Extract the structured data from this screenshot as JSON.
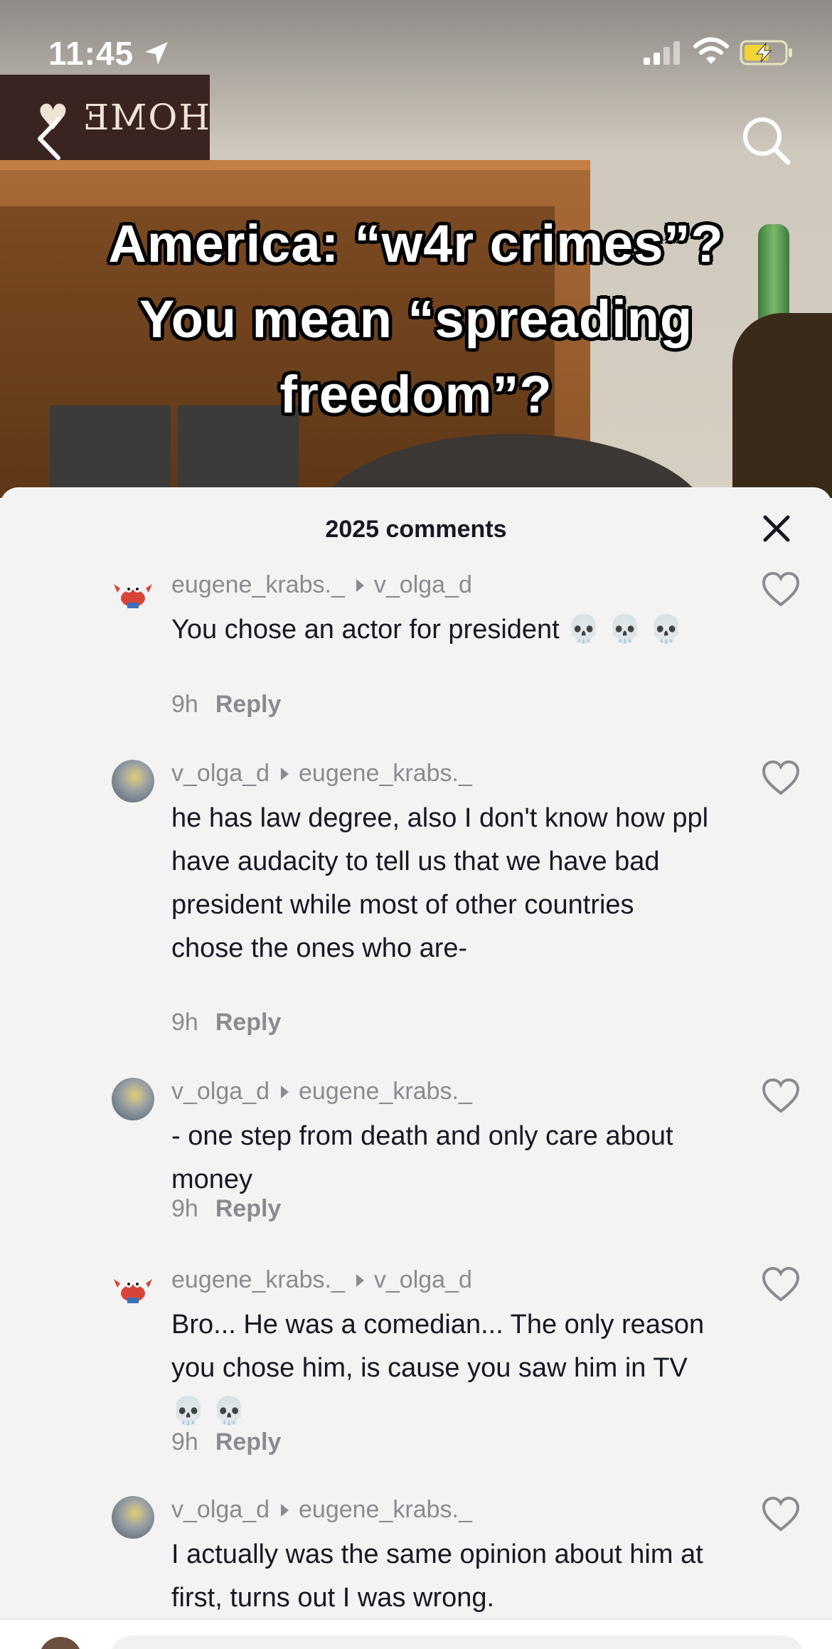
{
  "status_bar": {
    "time": "11:45"
  },
  "video": {
    "sign_text": "HOME ♥ HE",
    "caption_lines": [
      "America: “w4r crimes”?",
      "You mean “spreading",
      "freedom”?"
    ]
  },
  "comments_panel": {
    "title": "2025 comments",
    "comments": [
      {
        "user": "eugene_krabs._",
        "reply_to": "v_olga_d",
        "avatar": "krabs",
        "text": "You chose an actor for president 💀 💀 💀",
        "age": "9h",
        "reply_label": "Reply"
      },
      {
        "user": "v_olga_d",
        "reply_to": "eugene_krabs._",
        "avatar": "olga",
        "text": "he has law degree, also I don't know how ppl have audacity to tell us that we have bad president while most of other countries chose the ones who are-",
        "age": "9h",
        "reply_label": "Reply"
      },
      {
        "user": "v_olga_d",
        "reply_to": "eugene_krabs._",
        "avatar": "olga",
        "text": "- one step from death and only care about money",
        "age": "9h",
        "reply_label": "Reply"
      },
      {
        "user": "eugene_krabs._",
        "reply_to": "v_olga_d",
        "avatar": "krabs",
        "text": "Bro... He was a comedian... The only reason you chose him, is cause you saw him in TV 💀 💀",
        "age": "9h",
        "reply_label": "Reply"
      },
      {
        "user": "v_olga_d",
        "reply_to": "eugene_krabs._",
        "avatar": "olga",
        "text": "I actually was the same opinion about him at first, turns out I was wrong.",
        "age": "",
        "reply_label": ""
      }
    ]
  },
  "icons": {
    "back": "chevron-left-icon",
    "search": "search-icon",
    "close": "close-icon",
    "like": "heart-outline-icon",
    "location": "location-arrow-icon",
    "signal": "signal-icon",
    "wifi": "wifi-icon",
    "battery": "battery-charging-icon"
  },
  "colors": {
    "battery": "#f5d535",
    "meta": "#8a8b91",
    "text": "#161823"
  }
}
